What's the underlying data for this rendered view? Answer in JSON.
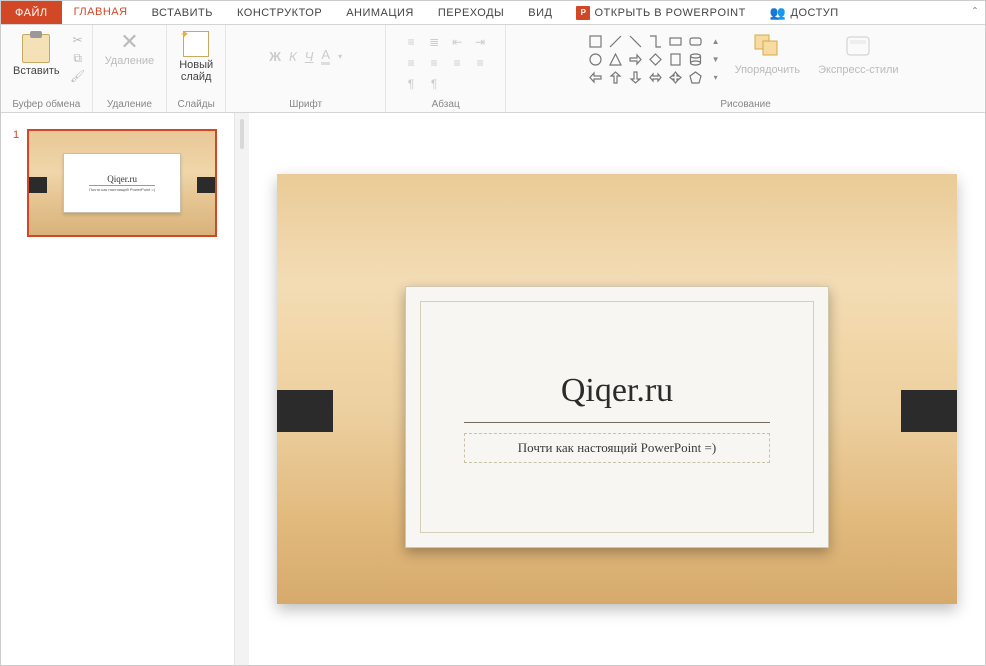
{
  "tabs": {
    "file": "ФАЙЛ",
    "home": "ГЛАВНАЯ",
    "insert": "ВСТАВИТЬ",
    "design": "КОНСТРУКТОР",
    "animation": "АНИМАЦИЯ",
    "transitions": "ПЕРЕХОДЫ",
    "view": "ВИД",
    "open_ppt": "ОТКРЫТЬ В POWERPOINT",
    "share": "ДОСТУП",
    "ppt_badge": "P"
  },
  "ribbon": {
    "clipboard": {
      "paste": "Вставить",
      "group": "Буфер обмена"
    },
    "delete": {
      "btn": "Удаление",
      "group": "Удаление"
    },
    "slides": {
      "new": "Новый\nслайд",
      "group": "Слайды"
    },
    "font": {
      "group": "Шрифт",
      "bold": "Ж",
      "italic": "К",
      "underline": "Ч",
      "color": "А"
    },
    "paragraph": {
      "group": "Абзац"
    },
    "drawing": {
      "group": "Рисование",
      "arrange": "Упорядочить",
      "styles": "Экспресс-стили"
    }
  },
  "thumbs": {
    "num1": "1"
  },
  "slide": {
    "title": "Qiqer.ru",
    "subtitle": "Почти как настоящий PowerPoint =)"
  }
}
